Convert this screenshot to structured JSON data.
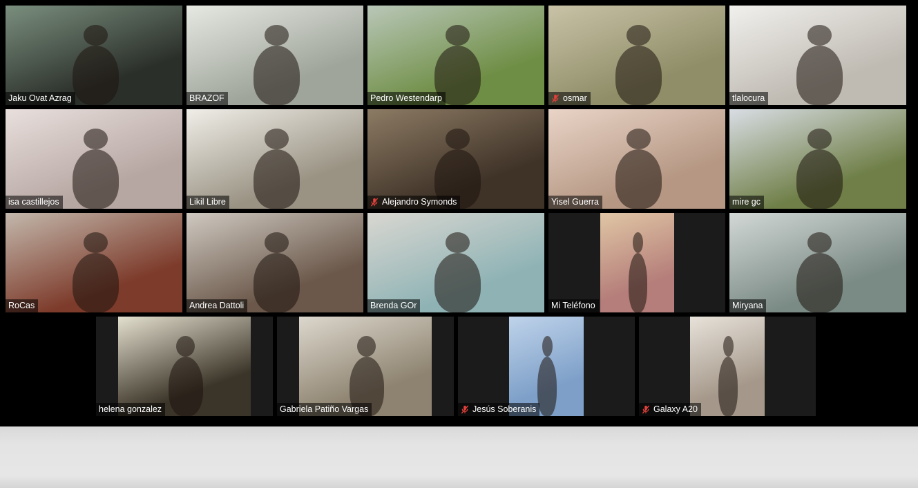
{
  "meeting": {
    "participants": [
      {
        "name": "Jaku Ovat Azrag",
        "muted": false,
        "active": false,
        "bg": "#2b2f2a",
        "bg2": "#7a8f7e"
      },
      {
        "name": "BRAZOF",
        "muted": false,
        "active": true,
        "bg": "#9fa59b",
        "bg2": "#e6e8e2"
      },
      {
        "name": "Pedro Westendarp",
        "muted": false,
        "active": false,
        "bg": "#6f8e45",
        "bg2": "#b9c7b8"
      },
      {
        "name": "osmar",
        "muted": true,
        "active": false,
        "bg": "#8f8e68",
        "bg2": "#c9c2a7"
      },
      {
        "name": "tlalocura",
        "muted": false,
        "active": false,
        "bg": "#bfbab2",
        "bg2": "#f1f0ed"
      },
      {
        "name": "isa castillejos",
        "muted": false,
        "active": false,
        "bg": "#b7a7a3",
        "bg2": "#e8dfdc"
      },
      {
        "name": "Likil Libre",
        "muted": false,
        "active": false,
        "bg": "#9a9384",
        "bg2": "#f0eee8"
      },
      {
        "name": "Alejandro Symonds",
        "muted": true,
        "active": false,
        "bg": "#3f3227",
        "bg2": "#8c7b64"
      },
      {
        "name": "Yisel Guerra",
        "muted": false,
        "active": false,
        "bg": "#b59783",
        "bg2": "#e9d4c7"
      },
      {
        "name": "mire gc",
        "muted": false,
        "active": false,
        "bg": "#6f7f47",
        "bg2": "#d9dde4"
      },
      {
        "name": "RoCas",
        "muted": false,
        "active": false,
        "bg": "#7d3b2b",
        "bg2": "#c3b8ac"
      },
      {
        "name": "Andrea Dattoli",
        "muted": false,
        "active": false,
        "bg": "#6b584a",
        "bg2": "#cfc9c1"
      },
      {
        "name": "Brenda GOr",
        "muted": false,
        "active": false,
        "bg": "#8fb3b5",
        "bg2": "#d9d7d1"
      },
      {
        "name": "Mi Teléfono",
        "muted": false,
        "active": false,
        "bg": "#b57e7a",
        "bg2": "#e0c6a5"
      },
      {
        "name": "Miryana",
        "muted": false,
        "active": false,
        "bg": "#7a8a84",
        "bg2": "#d2d8d6"
      },
      {
        "name": "helena gonzalez",
        "muted": false,
        "active": false,
        "bg": "#3b3428",
        "bg2": "#e4e0cf"
      },
      {
        "name": "Gabriela Patiño Vargas",
        "muted": false,
        "active": false,
        "bg": "#8e8370",
        "bg2": "#dcd7cd"
      },
      {
        "name": "Jesús Soberanis",
        "muted": true,
        "active": false,
        "bg": "#7d9fc8",
        "bg2": "#bfd3ea"
      },
      {
        "name": "Galaxy A20",
        "muted": true,
        "active": false,
        "bg": "#a5988a",
        "bg2": "#e7e2da"
      }
    ]
  },
  "colors": {
    "active_speaker_border": "#c8cf8a",
    "mute_red": "#e0403a",
    "toolbar_bg": "#e4e4e4"
  },
  "icons": {
    "muted": "microphone-muted-icon"
  }
}
